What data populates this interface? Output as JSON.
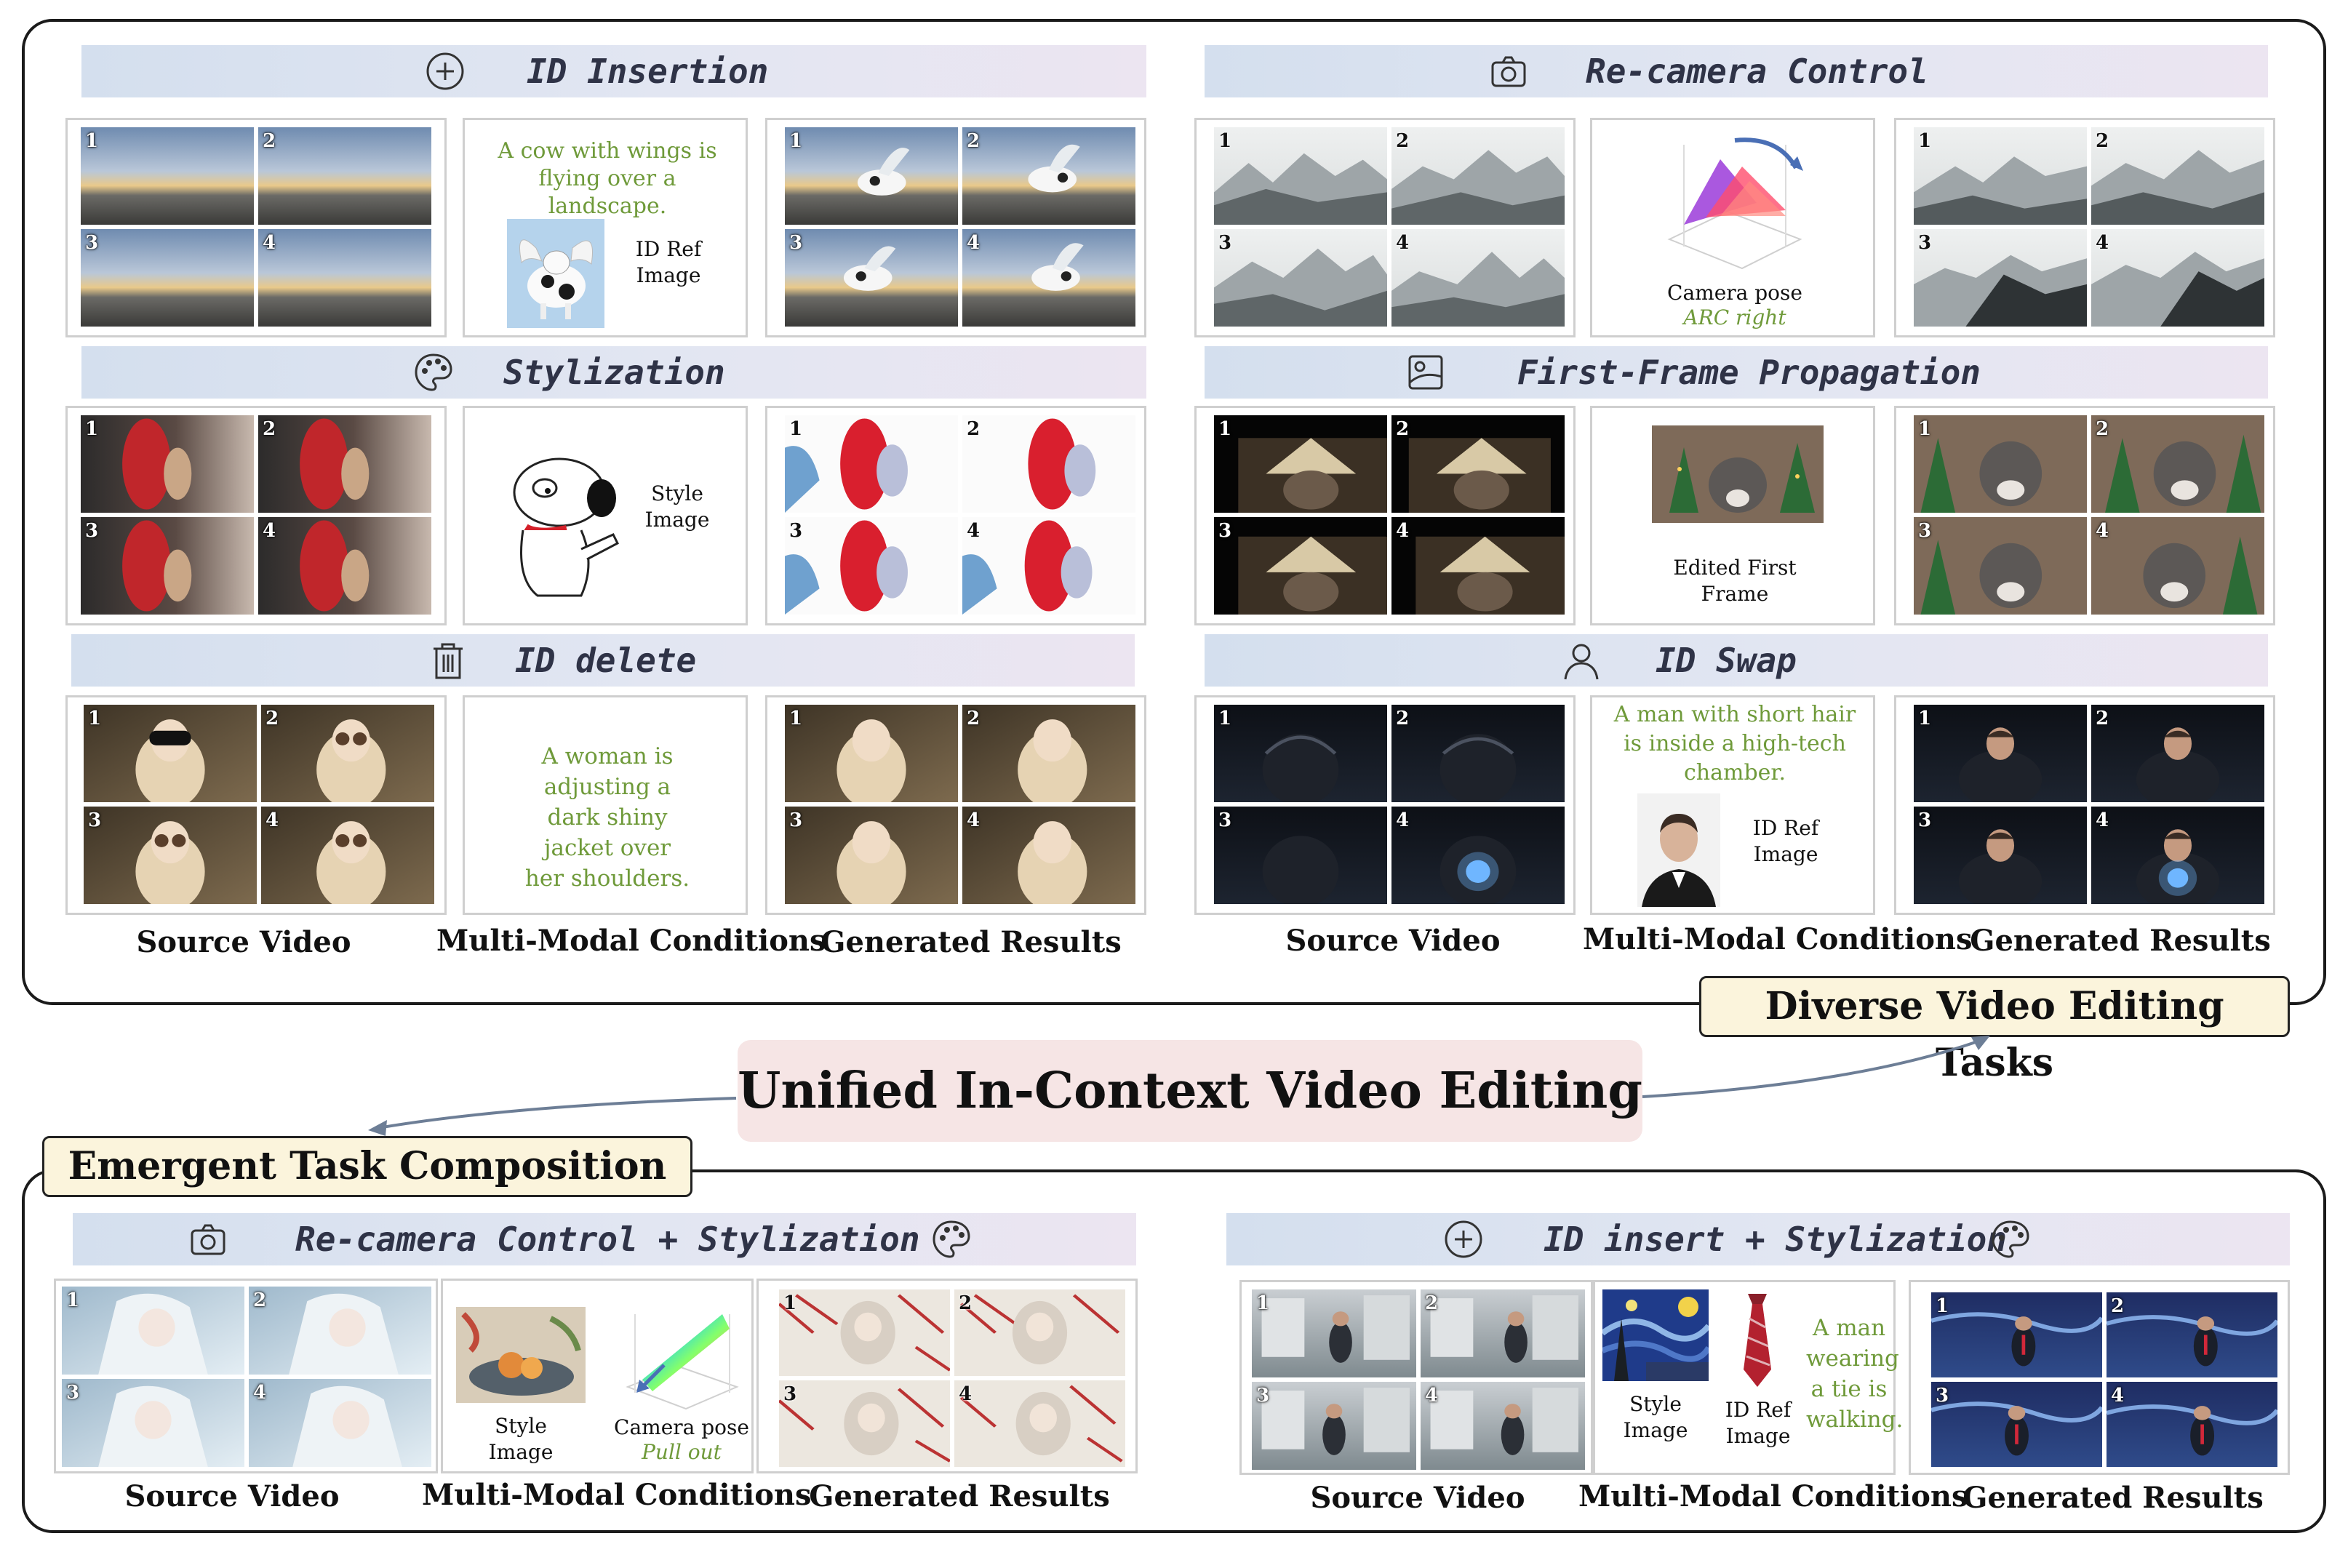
{
  "top_section": {
    "column_labels": [
      "Source Video",
      "Multi-Modal Conditions",
      "Generated Results"
    ],
    "tasks": {
      "id_insertion": {
        "title": "ID Insertion",
        "icon": "plus-circle-icon",
        "prompt": "A cow with wings is flying over a landscape.",
        "ref_label": "ID Ref Image",
        "source_frames": [
          "1",
          "2",
          "3",
          "4"
        ],
        "result_frames": [
          "1",
          "2",
          "3",
          "4"
        ]
      },
      "recamera": {
        "title": "Re-camera Control",
        "icon": "camera-icon",
        "caption": "Camera pose",
        "sub_caption": "ARC right",
        "source_frames": [
          "1",
          "2",
          "3",
          "4"
        ],
        "result_frames": [
          "1",
          "2",
          "3",
          "4"
        ]
      },
      "stylization": {
        "title": "Stylization",
        "icon": "palette-icon",
        "ref_label": "Style Image",
        "source_frames": [
          "1",
          "2",
          "3",
          "4"
        ],
        "result_frames": [
          "1",
          "2",
          "3",
          "4"
        ]
      },
      "first_frame": {
        "title": "First-Frame Propagation",
        "icon": "image-frame-icon",
        "caption": "Edited First Frame",
        "source_frames": [
          "1",
          "2",
          "3",
          "4"
        ],
        "result_frames": [
          "1",
          "2",
          "3",
          "4"
        ]
      },
      "id_delete": {
        "title": "ID delete",
        "icon": "trash-icon",
        "prompt": "A woman is adjusting a dark shiny jacket over her shoulders.",
        "source_frames": [
          "1",
          "2",
          "3",
          "4"
        ],
        "result_frames": [
          "1",
          "2",
          "3",
          "4"
        ]
      },
      "id_swap": {
        "title": "ID Swap",
        "icon": "person-icon",
        "prompt": "A man with short hair is inside a high-tech chamber.",
        "ref_label": "ID Ref Image",
        "source_frames": [
          "1",
          "2",
          "3",
          "4"
        ],
        "result_frames": [
          "1",
          "2",
          "3",
          "4"
        ]
      }
    }
  },
  "center": {
    "title": "Unified In-Context Video Editing",
    "right_note": "Diverse Video Editing Tasks",
    "left_note": "Emergent Task Composition"
  },
  "bottom_section": {
    "column_labels": [
      "Source Video",
      "Multi-Modal Conditions",
      "Generated Results"
    ],
    "tasks": {
      "recam_style": {
        "title": "Re-camera Control + Stylization",
        "icons": [
          "camera-icon",
          "palette-icon"
        ],
        "style_label": "Style Image",
        "caption": "Camera pose",
        "sub_caption": "Pull out",
        "source_frames": [
          "1",
          "2",
          "3",
          "4"
        ],
        "result_frames": [
          "1",
          "2",
          "3",
          "4"
        ]
      },
      "insert_style": {
        "title": "ID insert + Stylization",
        "icons": [
          "plus-circle-icon",
          "palette-icon"
        ],
        "style_label": "Style Image",
        "ref_label": "ID Ref Image",
        "prompt": "A man wearing a tie is walking.",
        "source_frames": [
          "1",
          "2",
          "3",
          "4"
        ],
        "result_frames": [
          "1",
          "2",
          "3",
          "4"
        ]
      }
    }
  }
}
